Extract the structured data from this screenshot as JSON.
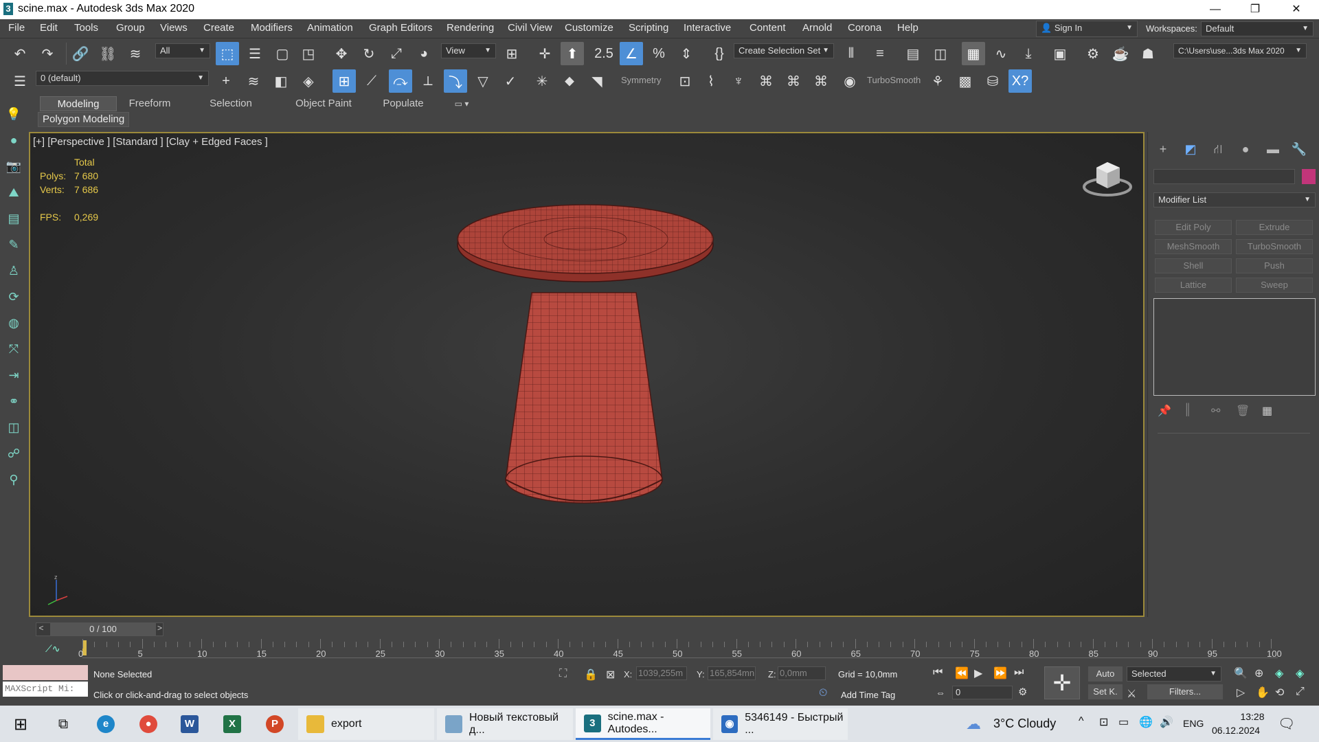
{
  "title": "scine.max - Autodesk 3ds Max 2020",
  "app_icon": "3",
  "window_controls": [
    "minimize-icon",
    "restore-icon",
    "close-icon"
  ],
  "menu": [
    "File",
    "Edit",
    "Tools",
    "Group",
    "Views",
    "Create",
    "Modifiers",
    "Animation",
    "Graph Editors",
    "Rendering",
    "Civil View",
    "Customize",
    "Scripting",
    "Interactive",
    "Content",
    "Arnold",
    "Corona",
    "Help"
  ],
  "sign_in": "Sign In",
  "workspaces_label": "Workspaces:",
  "workspaces_value": "Default",
  "toolbar": {
    "filter_all": "All",
    "ref_coord": "View",
    "create_selection_set": "Create Selection Set",
    "project_path": "C:\\Users\\use...3ds Max 2020",
    "layer": "0 (default)",
    "symmetry": "Symmetry",
    "turbosmooth": "TurboSmooth"
  },
  "ribbon_tabs": [
    "Modeling",
    "Freeform",
    "Selection",
    "Object Paint",
    "Populate"
  ],
  "ribbon_sub": "Polygon Modeling",
  "viewport": {
    "label": "[+] [Perspective ] [Standard ] [Clay + Edged Faces ]",
    "stats": {
      "total_label": "Total",
      "polys_label": "Polys:",
      "polys": "7 680",
      "verts_label": "Verts:",
      "verts": "7 686",
      "fps_label": "FPS:",
      "fps": "0,269"
    },
    "object_color": "#b84a40"
  },
  "command_panel": {
    "modifier_list": "Modifier List",
    "buttons": [
      "Edit Poly",
      "Extrude",
      "MeshSmooth",
      "TurboSmooth",
      "Shell",
      "Push",
      "Lattice",
      "Sweep"
    ],
    "color_swatch": "#c2357a"
  },
  "timeline": {
    "frame": "0 / 100",
    "ticks": [
      "0",
      "5",
      "10",
      "15",
      "20",
      "25",
      "30",
      "35",
      "40",
      "45",
      "50",
      "55",
      "60",
      "65",
      "70",
      "75",
      "80",
      "85",
      "90",
      "95",
      "100"
    ]
  },
  "status": {
    "maxscript": "MAXScript Mi:",
    "selection": "None Selected",
    "prompt": "Click or click-and-drag to select objects",
    "x_label": "X:",
    "x": "1039,255m",
    "y_label": "Y:",
    "y": "165,854mn",
    "z_label": "Z:",
    "z": "0,0mm",
    "grid": "Grid = 10,0mm",
    "add_time_tag": "Add Time Tag",
    "auto": "Auto",
    "set_key": "Set K.",
    "selected": "Selected",
    "filters": "Filters...",
    "frame_value": "0"
  },
  "taskbar": {
    "apps": [
      "export",
      "Новый текстовый д...",
      "scine.max - Autodes...",
      "5346149 - Быстрый ..."
    ],
    "weather": "3°C  Cloudy",
    "lang": "ENG",
    "time": "13:28",
    "date": "06.12.2024"
  }
}
